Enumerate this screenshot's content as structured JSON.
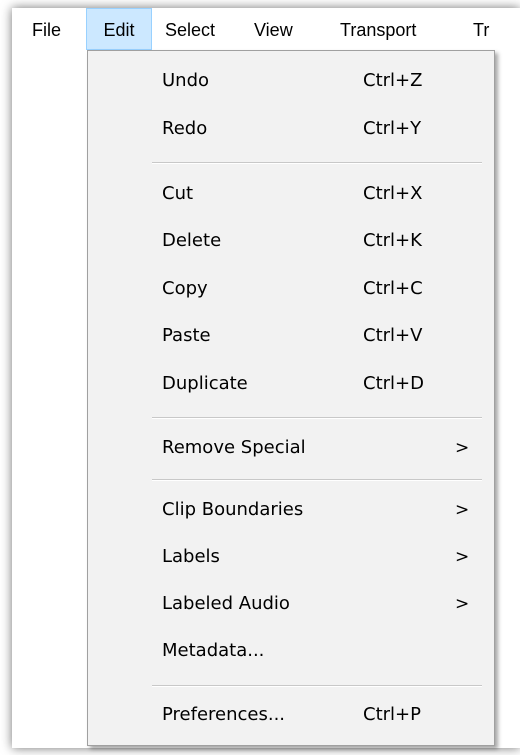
{
  "menubar": {
    "items": [
      {
        "label": "File"
      },
      {
        "label": "Edit"
      },
      {
        "label": "Select"
      },
      {
        "label": "View"
      },
      {
        "label": "Transport"
      },
      {
        "label": "Tr"
      }
    ],
    "active": "Edit"
  },
  "edit_menu": {
    "items": [
      {
        "label": "Undo",
        "shortcut": "Ctrl+Z"
      },
      {
        "label": "Redo",
        "shortcut": "Ctrl+Y"
      },
      {
        "label": "Cut",
        "shortcut": "Ctrl+X"
      },
      {
        "label": "Delete",
        "shortcut": "Ctrl+K"
      },
      {
        "label": "Copy",
        "shortcut": "Ctrl+C"
      },
      {
        "label": "Paste",
        "shortcut": "Ctrl+V"
      },
      {
        "label": "Duplicate",
        "shortcut": "Ctrl+D"
      },
      {
        "label": "Remove Special",
        "submenu_arrow": ">"
      },
      {
        "label": "Clip Boundaries",
        "submenu_arrow": ">"
      },
      {
        "label": "Labels",
        "submenu_arrow": ">"
      },
      {
        "label": "Labeled Audio",
        "submenu_arrow": ">"
      },
      {
        "label": "Metadata..."
      },
      {
        "label": "Preferences...",
        "shortcut": "Ctrl+P"
      }
    ]
  },
  "colors": {
    "menu_background": "#f2f2f2",
    "active_menubar_highlight": "#cce8ff",
    "active_menubar_border": "#99d1ff",
    "separator": "#c8c8c8"
  },
  "icons": {
    "submenu": "chevron-right-icon"
  }
}
